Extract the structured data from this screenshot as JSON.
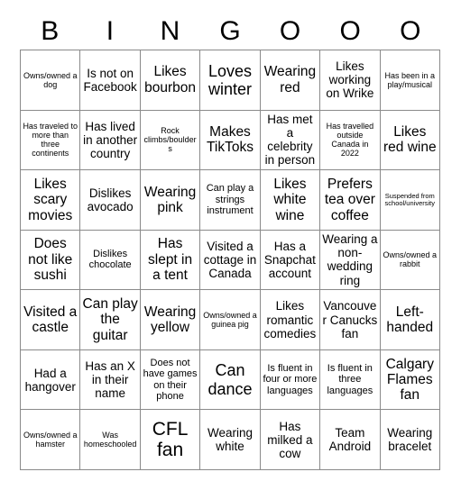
{
  "header": {
    "letters": [
      "B",
      "I",
      "N",
      "G",
      "O",
      "O",
      "O"
    ]
  },
  "grid": {
    "columns": 7,
    "rows": 7,
    "cells": [
      {
        "text": "Owns/owned a dog",
        "size": "xs"
      },
      {
        "text": "Is not on Facebook",
        "size": "md"
      },
      {
        "text": "Likes bourbon",
        "size": "lg"
      },
      {
        "text": "Loves winter",
        "size": "xl"
      },
      {
        "text": "Wearing red",
        "size": "lg"
      },
      {
        "text": "Likes working on Wrike",
        "size": "md"
      },
      {
        "text": "Has been in a play/musical",
        "size": "xs"
      },
      {
        "text": "Has traveled to more than three continents",
        "size": "xs"
      },
      {
        "text": "Has lived in another country",
        "size": "md"
      },
      {
        "text": "Rock climbs/boulders",
        "size": "xs"
      },
      {
        "text": "Makes TikToks",
        "size": "lg"
      },
      {
        "text": "Has met a celebrity in person",
        "size": "md"
      },
      {
        "text": "Has travelled outside Canada in 2022",
        "size": "xs"
      },
      {
        "text": "Likes red wine",
        "size": "lg"
      },
      {
        "text": "Likes scary movies",
        "size": "lg"
      },
      {
        "text": "Dislikes avocado",
        "size": "md"
      },
      {
        "text": "Wearing pink",
        "size": "lg"
      },
      {
        "text": "Can play a strings instrument",
        "size": "sm"
      },
      {
        "text": "Likes white wine",
        "size": "lg"
      },
      {
        "text": "Prefers tea over coffee",
        "size": "lg"
      },
      {
        "text": "Suspended from school/university",
        "size": "xxs"
      },
      {
        "text": "Does not like sushi",
        "size": "lg"
      },
      {
        "text": "Dislikes chocolate",
        "size": "sm"
      },
      {
        "text": "Has slept in a tent",
        "size": "lg"
      },
      {
        "text": "Visited a cottage in Canada",
        "size": "md"
      },
      {
        "text": "Has a Snapchat account",
        "size": "md"
      },
      {
        "text": "Wearing a non-wedding ring",
        "size": "md"
      },
      {
        "text": "Owns/owned a rabbit",
        "size": "xs"
      },
      {
        "text": "Visited a castle",
        "size": "lg"
      },
      {
        "text": "Can play the guitar",
        "size": "lg"
      },
      {
        "text": "Wearing yellow",
        "size": "lg"
      },
      {
        "text": "Owns/owned a guinea pig",
        "size": "xs"
      },
      {
        "text": "Likes romantic comedies",
        "size": "md"
      },
      {
        "text": "Vancouver Canucks fan",
        "size": "md"
      },
      {
        "text": "Left-handed",
        "size": "lg"
      },
      {
        "text": "Had a hangover",
        "size": "md"
      },
      {
        "text": "Has an X in their name",
        "size": "md"
      },
      {
        "text": "Does not have games on their phone",
        "size": "sm"
      },
      {
        "text": "Can dance",
        "size": "xl"
      },
      {
        "text": "Is fluent in four or more languages",
        "size": "sm"
      },
      {
        "text": "Is fluent in three languages",
        "size": "sm"
      },
      {
        "text": "Calgary Flames fan",
        "size": "lg"
      },
      {
        "text": "Owns/owned a hamster",
        "size": "xs"
      },
      {
        "text": "Was homeschooled",
        "size": "xs"
      },
      {
        "text": "CFL fan",
        "size": "xxl"
      },
      {
        "text": "Wearing white",
        "size": "md"
      },
      {
        "text": "Has milked a cow",
        "size": "md"
      },
      {
        "text": "Team Android",
        "size": "md"
      },
      {
        "text": "Wearing bracelet",
        "size": "md"
      }
    ]
  },
  "colors": {
    "background": "#ffffff",
    "grid_line": "#8a8a8a",
    "text": "#000000"
  }
}
